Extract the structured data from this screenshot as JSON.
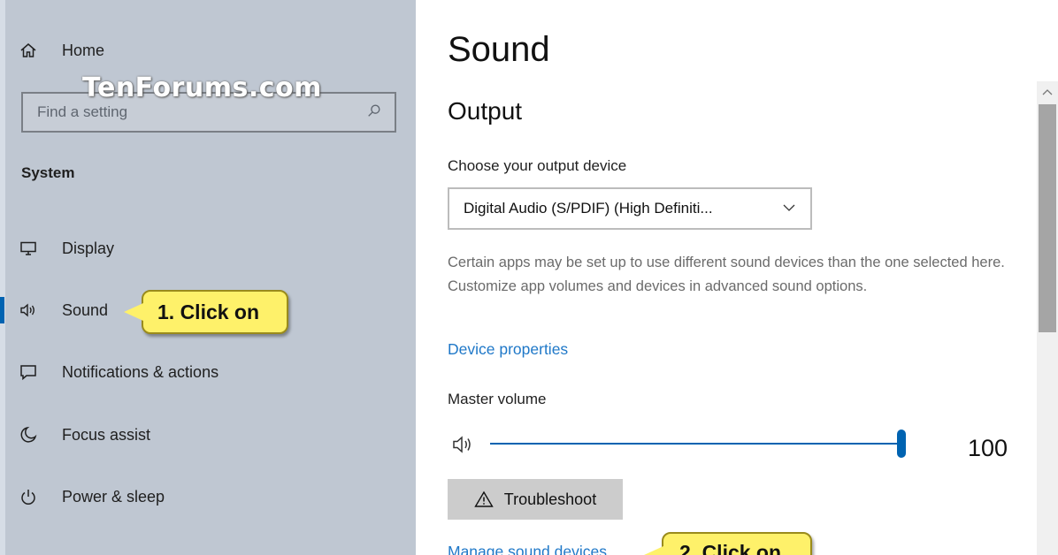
{
  "sidebar": {
    "home_label": "Home",
    "search_placeholder": "Find a setting",
    "section_label": "System",
    "items": [
      {
        "label": "Display",
        "icon": "display-icon"
      },
      {
        "label": "Sound",
        "icon": "speaker-icon"
      },
      {
        "label": "Notifications & actions",
        "icon": "notifications-icon"
      },
      {
        "label": "Focus assist",
        "icon": "moon-icon"
      },
      {
        "label": "Power & sleep",
        "icon": "power-icon"
      }
    ]
  },
  "watermark": "TenForums.com",
  "callouts": {
    "step1": "1. Click on",
    "step2": "2. Click on"
  },
  "main": {
    "title": "Sound",
    "output_heading": "Output",
    "output_device_label": "Choose your output device",
    "output_device_value": "Digital Audio (S/PDIF) (High Definiti...",
    "description": "Certain apps may be set up to use different sound devices than the one selected here. Customize app volumes and devices in advanced sound options.",
    "device_properties_link": "Device properties",
    "master_volume_label": "Master volume",
    "master_volume_value": "100",
    "master_volume_level": 1.0,
    "troubleshoot_label": "Troubleshoot",
    "manage_link": "Manage sound devices"
  },
  "colors": {
    "sidebar_bg": "#bfc7d2",
    "accent": "#0063b1",
    "link": "#1f78c8",
    "callout": "#fef16a"
  }
}
